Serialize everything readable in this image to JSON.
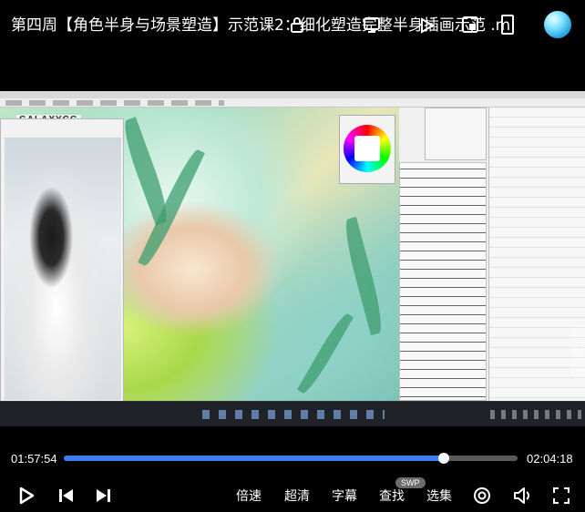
{
  "header": {
    "title": "第四周【角色半身与场景塑造】示范课2：细化塑造完整半身插画示范 .mp4"
  },
  "video": {
    "watermark": "GALAXYCG"
  },
  "player": {
    "time_current": "01:57:54",
    "time_total": "02:04:18",
    "progress_fraction": 0.8365
  },
  "controls": {
    "speed_label": "倍速",
    "quality_label": "超清",
    "subtitle_label": "字幕",
    "search_label": "查找",
    "episodes_label": "选集",
    "swp_badge": "SWP"
  },
  "colors": {
    "accent": "#3f7cf2",
    "background": "#000000"
  }
}
